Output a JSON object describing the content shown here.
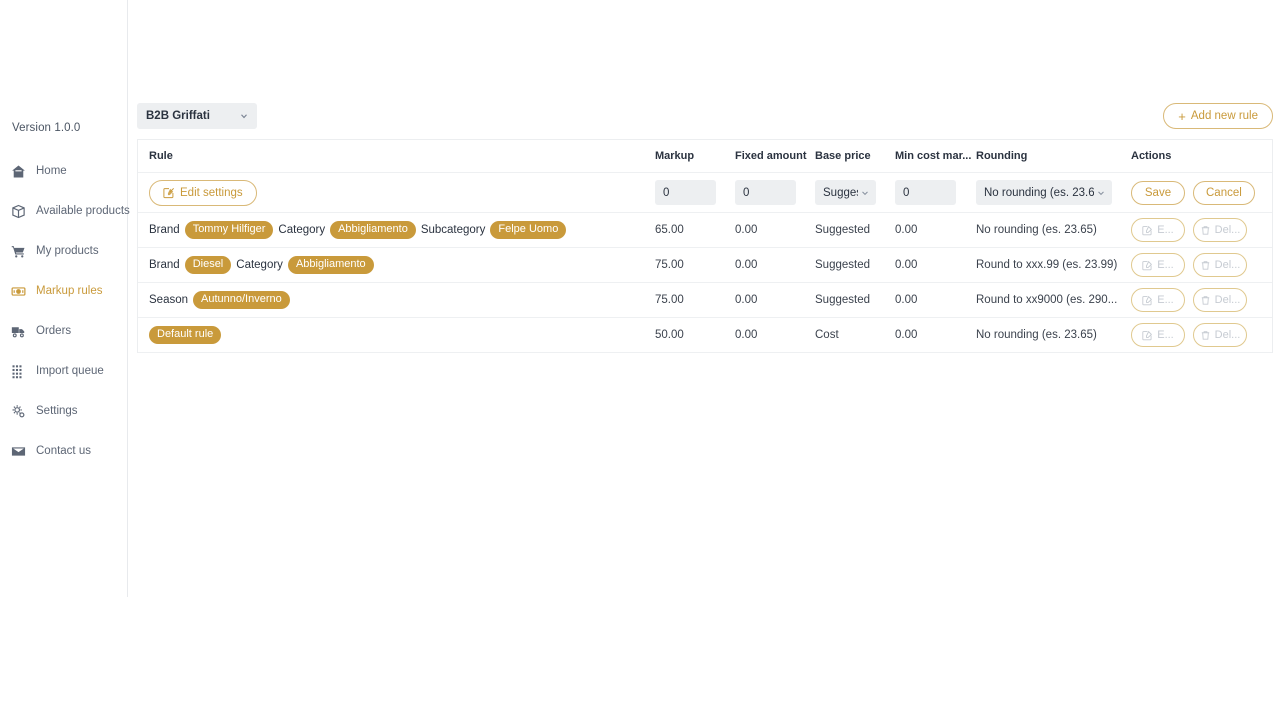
{
  "sidebar": {
    "version": "Version 1.0.0",
    "items": [
      {
        "label": "Home",
        "icon": "home-icon",
        "active": false
      },
      {
        "label": "Available products",
        "icon": "box-icon",
        "active": false
      },
      {
        "label": "My products",
        "icon": "cart-icon",
        "active": false
      },
      {
        "label": "Markup rules",
        "icon": "money-icon",
        "active": true
      },
      {
        "label": "Orders",
        "icon": "truck-icon",
        "active": false
      },
      {
        "label": "Import queue",
        "icon": "grid-icon",
        "active": false
      },
      {
        "label": "Settings",
        "icon": "gear-icon",
        "active": false
      },
      {
        "label": "Contact us",
        "icon": "envelope-icon",
        "active": false
      }
    ]
  },
  "topbar": {
    "store_selected": "B2B Griffati",
    "add_rule_label": "Add new rule",
    "add_rule_plus": "+"
  },
  "table": {
    "headers": {
      "rule": "Rule",
      "markup": "Markup",
      "fixed_amount": "Fixed amount",
      "base_price": "Base price",
      "min_cost_margin": "Min cost mar...",
      "rounding": "Rounding",
      "actions": "Actions"
    },
    "edit_row": {
      "edit_settings_label": "Edit settings",
      "markup_value": "0",
      "fixed_amount_value": "0",
      "base_price_value": "Sugges",
      "min_cost_value": "0",
      "rounding_value": "No rounding (es. 23.65",
      "save_label": "Save",
      "cancel_label": "Cancel"
    },
    "rows": [
      {
        "rule_parts": [
          {
            "type": "text",
            "text": "Brand"
          },
          {
            "type": "tag",
            "text": "Tommy Hilfiger"
          },
          {
            "type": "text",
            "text": "Category"
          },
          {
            "type": "tag",
            "text": "Abbigliamento"
          },
          {
            "type": "text",
            "text": "Subcategory"
          },
          {
            "type": "tag",
            "text": "Felpe Uomo"
          }
        ],
        "markup": "65.00",
        "fixed_amount": "0.00",
        "base_price": "Suggested",
        "min_cost_margin": "0.00",
        "rounding": "No rounding (es. 23.65)",
        "edit_label": "E...",
        "delete_label": "Del..."
      },
      {
        "rule_parts": [
          {
            "type": "text",
            "text": "Brand"
          },
          {
            "type": "tag",
            "text": "Diesel"
          },
          {
            "type": "text",
            "text": "Category"
          },
          {
            "type": "tag",
            "text": "Abbigliamento"
          }
        ],
        "markup": "75.00",
        "fixed_amount": "0.00",
        "base_price": "Suggested",
        "min_cost_margin": "0.00",
        "rounding": "Round to xxx.99 (es. 23.99)",
        "edit_label": "E...",
        "delete_label": "Del..."
      },
      {
        "rule_parts": [
          {
            "type": "text",
            "text": "Season"
          },
          {
            "type": "tag",
            "text": "Autunno/Inverno"
          }
        ],
        "markup": "75.00",
        "fixed_amount": "0.00",
        "base_price": "Suggested",
        "min_cost_margin": "0.00",
        "rounding": "Round to xx9000 (es. 290...",
        "edit_label": "E...",
        "delete_label": "Del..."
      },
      {
        "rule_parts": [
          {
            "type": "tag",
            "text": "Default rule"
          }
        ],
        "markup": "50.00",
        "fixed_amount": "0.00",
        "base_price": "Cost",
        "min_cost_margin": "0.00",
        "rounding": "No rounding (es. 23.65)",
        "edit_label": "E...",
        "delete_label": "Del..."
      }
    ]
  },
  "colors": {
    "accent": "#c99a3b",
    "accent_border": "#d9b978",
    "input_bg": "#edeff1",
    "text": "#2b3340",
    "muted": "#5d6675"
  }
}
